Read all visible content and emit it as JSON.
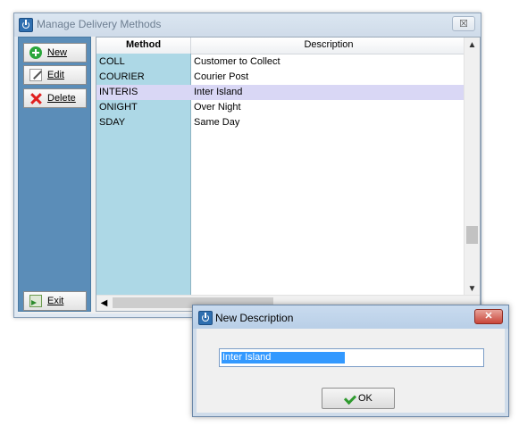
{
  "main_window": {
    "title": "Manage Delivery Methods",
    "close_glyph": "☒"
  },
  "toolbar": {
    "new_label": "New",
    "edit_label": "Edit",
    "delete_label": "Delete",
    "exit_label": "Exit"
  },
  "grid": {
    "columns": [
      "Method",
      "Description"
    ],
    "rows": [
      {
        "method": "COLL",
        "description": "Customer to Collect"
      },
      {
        "method": "COURIER",
        "description": "Courier Post"
      },
      {
        "method": "INTERIS",
        "description": "Inter Island"
      },
      {
        "method": "ONIGHT",
        "description": "Over Night"
      },
      {
        "method": "SDAY",
        "description": "Same Day"
      }
    ],
    "selected_row": 2
  },
  "dialog": {
    "title": "New Description",
    "close_glyph": "✕",
    "input_value": "Inter Island",
    "ok_label": "OK"
  },
  "colors": {
    "side_panel": "#5b8db8",
    "method_column": "#add8e6",
    "selected_row": "#d9d7f5",
    "text_selection": "#3399ff"
  }
}
